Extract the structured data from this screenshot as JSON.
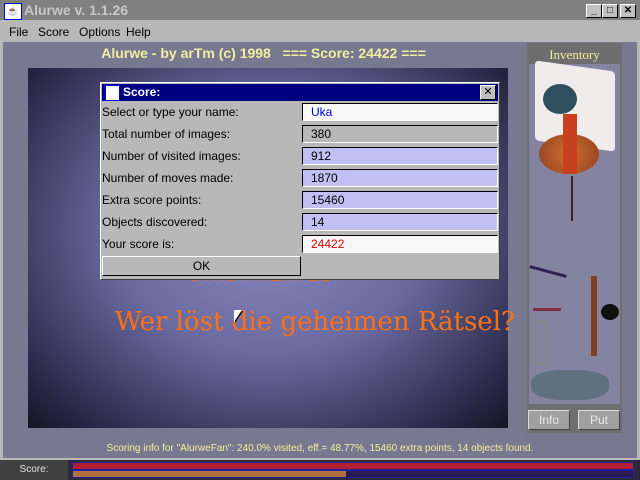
{
  "window": {
    "title": "Alurwe v. 1.1.26",
    "controls": {
      "minimize": "_",
      "maximize": "□",
      "close": "✕"
    }
  },
  "menu": [
    "File",
    "Score",
    "Options",
    "Help"
  ],
  "header": "Alurwe - by arTm (c) 1998   === Score: 24422 ===",
  "scene": {
    "subtitle": "STADTVIERTEL",
    "text": "Wer löst die geheimen Rätsel?"
  },
  "inventory": {
    "title": "Inventory",
    "items": [
      "poster",
      "candle",
      "coins",
      "rope",
      "rod",
      "cotter-pin",
      "key",
      "hatchet",
      "car-key",
      "keyring"
    ],
    "info_label": "Info",
    "put_label": "Put"
  },
  "scoring_info": "Scoring info for \"AlurweFan\": 240.0% visited, eff.= 48.77%, 15460 extra points, 14 objects found.",
  "status": {
    "label": "Score:",
    "bar1_fraction": 1.0,
    "bar2_fraction": 0.4877,
    "bar1_color": "#b02030",
    "bar2_color": "#b07040"
  },
  "dialog": {
    "title": "Score:",
    "close": "✕",
    "rows": [
      {
        "label": "Select or type your name:",
        "value": "Uka"
      },
      {
        "label": "Total number of images:",
        "value": "380"
      },
      {
        "label": "Number of visited images:",
        "value": "912"
      },
      {
        "label": "Number of moves made:",
        "value": "1870"
      },
      {
        "label": "Extra score points:",
        "value": "15460"
      },
      {
        "label": "Objects discovered:",
        "value": "14"
      },
      {
        "label": "Your score is:",
        "value": "24422"
      }
    ],
    "ok_label": "OK"
  }
}
